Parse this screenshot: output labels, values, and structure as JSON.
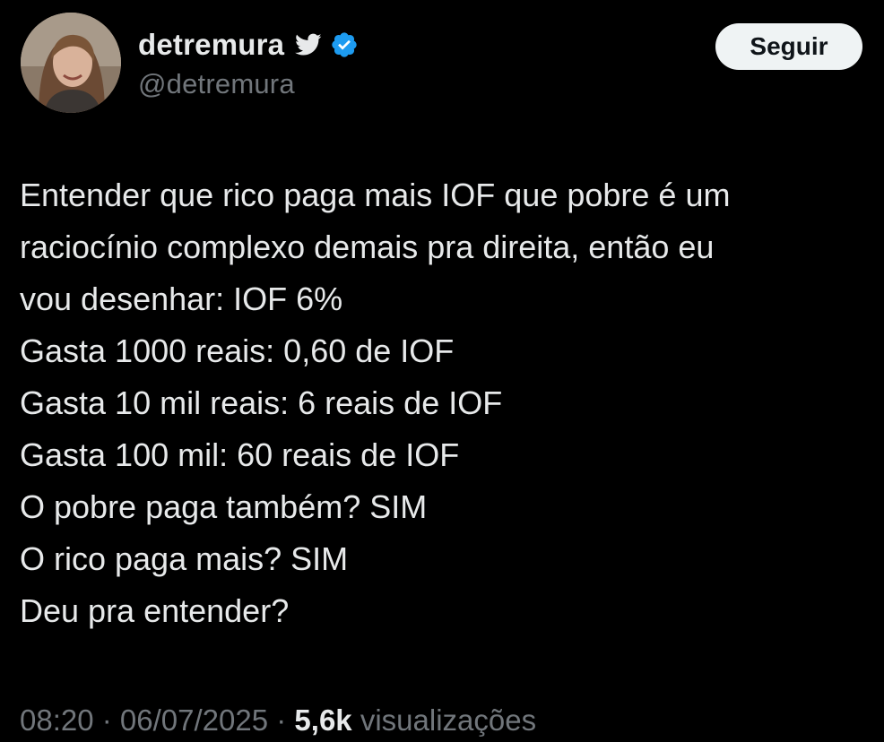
{
  "author": {
    "display_name": "detremura",
    "handle": "@detremura",
    "badge_icon": "verified-badge-icon",
    "platform_icon": "twitter-bird-icon",
    "verified_color": "#1d9bf0"
  },
  "follow_button": {
    "label": "Seguir"
  },
  "tweet": {
    "lines": [
      "Entender que rico paga mais IOF que pobre é um",
      "raciocínio complexo demais pra direita, então eu",
      "vou desenhar: IOF 6%",
      "Gasta 1000 reais: 0,60 de IOF",
      "Gasta 10 mil reais: 6 reais de IOF",
      "Gasta 100 mil: 60 reais de IOF",
      "O pobre paga também? SIM",
      "O rico paga mais? SIM",
      "Deu pra entender?"
    ]
  },
  "meta": {
    "time": "08:20",
    "separator": " · ",
    "date": "06/07/2025",
    "views_count": "5,6k",
    "views_label": "visualizações"
  },
  "colors": {
    "background": "#000000",
    "primary_text": "#e7e9ea",
    "secondary_text": "#71767b",
    "button_bg": "#eff3f4",
    "button_text": "#0f1419"
  }
}
